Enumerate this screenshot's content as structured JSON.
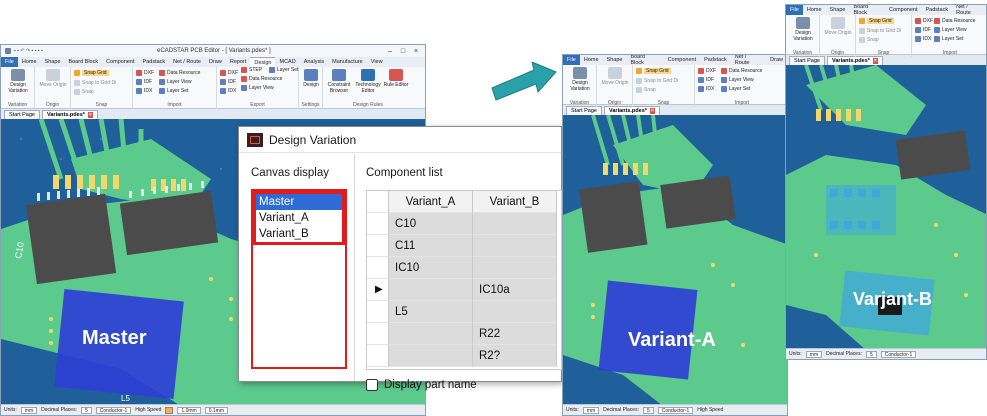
{
  "app": {
    "title": "eCADSTAR PCB Editor - [ Variants.pdes* ]",
    "ribbon_tabs": [
      "File",
      "Home",
      "Shape",
      "Board Block",
      "Component",
      "Padstack",
      "Net / Route",
      "Draw",
      "Report",
      "Design",
      "MCAD",
      "Analysis",
      "Manufacture",
      "View"
    ],
    "active_tab": "Design",
    "groups": {
      "variation": {
        "label": "Variation",
        "button": "Design Variation"
      },
      "origin": {
        "label": "Origin",
        "button": "Move Origin"
      },
      "snap": {
        "label": "Snap",
        "snap_grid": "Snap Grid",
        "snap_item2": "Snap to Grid Di",
        "snap_item3": "Snap"
      },
      "import": {
        "label": "Import",
        "items": [
          "DXF",
          "IDF",
          "IDX",
          "Data Resource",
          "Layer View",
          "Layer Set"
        ]
      },
      "export": {
        "label": "Export",
        "items": [
          "DXF",
          "IDF",
          "IDX",
          "STEP",
          "Data Resource",
          "Layer View",
          "Layer Set"
        ]
      },
      "settings": {
        "label": "Settings",
        "button": "Design"
      },
      "design_rules": {
        "label": "Design Rules",
        "buttons": [
          "Constraint Browser",
          "Technology Editor",
          "Rule Editor"
        ]
      }
    },
    "doc_tabs": [
      "Start Page",
      "Variants.pdes*"
    ],
    "status": {
      "units_label": "Units:",
      "units": "mm",
      "decimal_label": "Decimal Places:",
      "decimal": "5",
      "layer": "Conductor-1",
      "speed": "High Speed",
      "grid1": "1.0mm",
      "grid2": "0.1mm"
    }
  },
  "overlays": {
    "left_label": "Master",
    "middle_label": "Variant-A",
    "right_label": "Varjant-B",
    "canvas_text_c10": "C10",
    "canvas_text_l5": "L5"
  },
  "dialog": {
    "title": "Design Variation",
    "canvas_display_label": "Canvas display",
    "component_list_label": "Component list",
    "variants": [
      "Master",
      "Variant_A",
      "Variant_B"
    ],
    "selected_variant": "Master",
    "columns": [
      "Variant_A",
      "Variant_B"
    ],
    "rows": [
      {
        "name": "C10",
        "b": ""
      },
      {
        "name": "C11",
        "b": ""
      },
      {
        "name": "IC10",
        "b": ""
      },
      {
        "name": "",
        "b": "IC10a",
        "marker": "▶"
      },
      {
        "name": "L5",
        "b": ""
      },
      {
        "name": "",
        "b": "R22"
      },
      {
        "name": "",
        "b": "R2?"
      }
    ],
    "display_part_name": "Display part name"
  },
  "colors": {
    "board_green": "#5cc98d",
    "board_dark": "#1f5f9a",
    "copper_yellow": "#f2d86a",
    "ic_gray": "#4b4b4b",
    "highlight_blue": "#2f3fd6",
    "selection_red": "#e21b1b",
    "arrow_teal": "#2aa1a8"
  }
}
